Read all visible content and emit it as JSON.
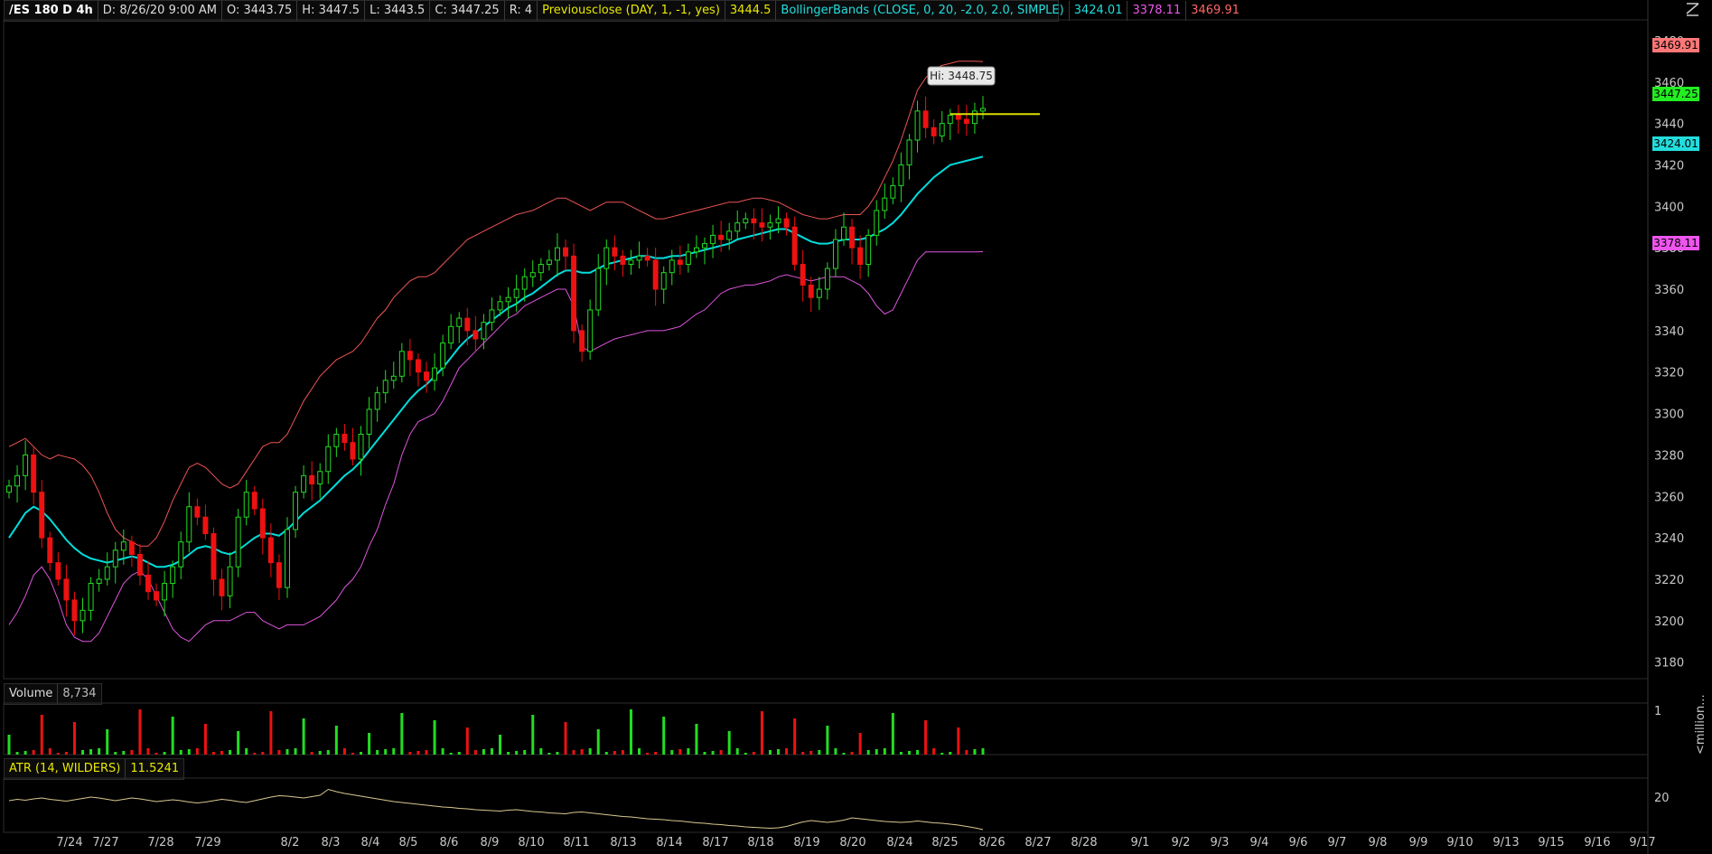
{
  "header": {
    "symbol": "/ES 180 D 4h",
    "datetime": "D: 8/26/20 9:00 AM",
    "open": "O: 3443.75",
    "high": "H: 3447.5",
    "low": "L: 3443.5",
    "close": "C: 3447.25",
    "range": "R: 4",
    "prevclose_label": "Previousclose (DAY, 1, -1, yes)",
    "prevclose_value": "3444.5",
    "bb_label": "BollingerBands (CLOSE, 0, 20, -2.0, 2.0, SIMPLE)",
    "bb_mid": "3424.01",
    "bb_low": "3378.11",
    "bb_up": "3469.91"
  },
  "volume_panel": {
    "label": "Volume",
    "value": "8,734",
    "axis_label": "1",
    "unit_label": "<million..."
  },
  "atr_panel": {
    "label": "ATR (14, WILDERS)",
    "value": "11.5241",
    "axis_label": "20"
  },
  "tooltip": "Hi: 3448.75",
  "colors": {
    "up": "#22dd22",
    "down": "#ee1111",
    "mid": "#00dddd",
    "upper": "#ee5555",
    "lower": "#dd55dd",
    "prevclose": "#dddd00",
    "atr": "#d8c890"
  },
  "chart_data": {
    "type": "candlestick",
    "title": "/ES 180 D 4h",
    "y_ticks": [
      3180,
      3200,
      3220,
      3240,
      3260,
      3280,
      3300,
      3320,
      3340,
      3360,
      3380,
      3400,
      3420,
      3440,
      3460,
      3480
    ],
    "ylim": [
      3172,
      3490
    ],
    "x_ticks": [
      "7/24",
      "7/27",
      "7/28",
      "7/29",
      "8/2",
      "8/3",
      "8/4",
      "8/5",
      "8/6",
      "8/9",
      "8/10",
      "8/11",
      "8/13",
      "8/14",
      "8/17",
      "8/18",
      "8/19",
      "8/20",
      "8/24",
      "8/25",
      "8/26",
      "8/27",
      "8/28",
      "9/1",
      "9/2",
      "9/3",
      "9/4",
      "9/6",
      "9/7",
      "9/8",
      "9/9",
      "9/10",
      "9/13",
      "9/15",
      "9/16",
      "9/17"
    ],
    "price_tags": {
      "bb_upper": "3469.91",
      "last": "3447.25",
      "bb_mid": "3424.01",
      "bb_lower": "3378.11"
    },
    "previous_close": 3444.5,
    "close_series": [
      3265,
      3270,
      3280,
      3262,
      3240,
      3228,
      3220,
      3210,
      3200,
      3205,
      3218,
      3220,
      3226,
      3234,
      3238,
      3232,
      3222,
      3214,
      3210,
      3218,
      3226,
      3238,
      3255,
      3250,
      3242,
      3220,
      3212,
      3226,
      3250,
      3262,
      3254,
      3240,
      3228,
      3216,
      3244,
      3262,
      3270,
      3266,
      3272,
      3284,
      3290,
      3286,
      3278,
      3290,
      3302,
      3310,
      3316,
      3318,
      3330,
      3326,
      3320,
      3316,
      3322,
      3334,
      3342,
      3346,
      3340,
      3336,
      3344,
      3350,
      3354,
      3356,
      3360,
      3366,
      3368,
      3372,
      3374,
      3380,
      3376,
      3340,
      3330,
      3350,
      3370,
      3380,
      3376,
      3372,
      3374,
      3376,
      3374,
      3360,
      3368,
      3374,
      3372,
      3378,
      3380,
      3382,
      3386,
      3384,
      3388,
      3392,
      3394,
      3392,
      3390,
      3392,
      3394,
      3390,
      3372,
      3362,
      3356,
      3360,
      3370,
      3384,
      3390,
      3380,
      3372,
      3386,
      3398,
      3404,
      3410,
      3420,
      3432,
      3446,
      3438,
      3434,
      3440,
      3444,
      3442,
      3440,
      3446,
      3447.25
    ],
    "bb_mid": [
      3240,
      3246,
      3252,
      3255,
      3253,
      3249,
      3244,
      3239,
      3235,
      3232,
      3230,
      3229,
      3228,
      3229,
      3230,
      3231,
      3230,
      3228,
      3226,
      3226,
      3227,
      3229,
      3232,
      3235,
      3236,
      3235,
      3233,
      3232,
      3234,
      3237,
      3240,
      3242,
      3242,
      3241,
      3244,
      3248,
      3252,
      3255,
      3258,
      3262,
      3266,
      3270,
      3273,
      3277,
      3282,
      3287,
      3292,
      3297,
      3302,
      3307,
      3311,
      3314,
      3318,
      3322,
      3327,
      3332,
      3336,
      3339,
      3342,
      3345,
      3348,
      3351,
      3353,
      3356,
      3358,
      3361,
      3364,
      3367,
      3369,
      3369,
      3368,
      3368,
      3370,
      3372,
      3373,
      3374,
      3375,
      3376,
      3376,
      3375,
      3375,
      3376,
      3376,
      3377,
      3378,
      3379,
      3380,
      3381,
      3382,
      3384,
      3385,
      3386,
      3387,
      3388,
      3389,
      3389,
      3387,
      3385,
      3383,
      3382,
      3382,
      3383,
      3384,
      3384,
      3384,
      3385,
      3387,
      3389,
      3392,
      3396,
      3401,
      3406,
      3410,
      3414,
      3417,
      3420,
      3421,
      3422,
      3423,
      3424.01
    ],
    "bb_upper": [
      3284,
      3286,
      3288,
      3284,
      3280,
      3278,
      3280,
      3279,
      3278,
      3275,
      3270,
      3262,
      3252,
      3244,
      3240,
      3238,
      3236,
      3236,
      3240,
      3248,
      3258,
      3266,
      3274,
      3276,
      3274,
      3270,
      3266,
      3264,
      3266,
      3272,
      3278,
      3284,
      3286,
      3286,
      3290,
      3298,
      3306,
      3312,
      3318,
      3322,
      3326,
      3328,
      3330,
      3334,
      3340,
      3346,
      3350,
      3356,
      3360,
      3364,
      3366,
      3366,
      3368,
      3372,
      3376,
      3380,
      3384,
      3386,
      3388,
      3390,
      3392,
      3394,
      3396,
      3397,
      3398,
      3400,
      3402,
      3404,
      3404,
      3402,
      3400,
      3398,
      3400,
      3402,
      3402,
      3402,
      3400,
      3398,
      3396,
      3394,
      3394,
      3395,
      3396,
      3397,
      3398,
      3399,
      3400,
      3401,
      3402,
      3402,
      3403,
      3404,
      3404,
      3403,
      3402,
      3400,
      3398,
      3396,
      3395,
      3394,
      3394,
      3395,
      3396,
      3396,
      3396,
      3400,
      3406,
      3414,
      3422,
      3432,
      3444,
      3456,
      3462,
      3466,
      3468,
      3469,
      3470,
      3470,
      3470,
      3469.91
    ],
    "bb_lower": [
      3198,
      3204,
      3212,
      3222,
      3226,
      3220,
      3210,
      3198,
      3192,
      3190,
      3190,
      3194,
      3202,
      3210,
      3218,
      3222,
      3224,
      3220,
      3212,
      3204,
      3196,
      3192,
      3190,
      3194,
      3198,
      3200,
      3200,
      3200,
      3202,
      3204,
      3204,
      3200,
      3198,
      3196,
      3198,
      3198,
      3198,
      3200,
      3202,
      3206,
      3210,
      3216,
      3220,
      3226,
      3236,
      3244,
      3256,
      3266,
      3280,
      3290,
      3296,
      3298,
      3300,
      3306,
      3314,
      3322,
      3326,
      3330,
      3334,
      3338,
      3342,
      3346,
      3348,
      3352,
      3354,
      3356,
      3358,
      3360,
      3360,
      3352,
      3332,
      3330,
      3332,
      3334,
      3336,
      3337,
      3338,
      3339,
      3340,
      3340,
      3340,
      3341,
      3342,
      3345,
      3348,
      3350,
      3354,
      3358,
      3360,
      3361,
      3362,
      3362,
      3363,
      3364,
      3366,
      3367,
      3366,
      3365,
      3364,
      3365,
      3366,
      3366,
      3366,
      3364,
      3362,
      3358,
      3352,
      3348,
      3350,
      3358,
      3366,
      3374,
      3378,
      3378,
      3378,
      3378,
      3378,
      3378,
      3378,
      3378.11
    ],
    "atr_ylim": [
      15,
      27
    ],
    "atr_series": [
      22,
      22.3,
      22.1,
      22.4,
      22.6,
      22.3,
      22.1,
      21.9,
      22.2,
      22.5,
      22.8,
      22.6,
      22.3,
      22.0,
      22.3,
      22.6,
      22.4,
      22.1,
      21.8,
      22.0,
      22.2,
      22.0,
      21.7,
      21.5,
      21.7,
      22.0,
      22.3,
      22.1,
      21.8,
      21.6,
      22.0,
      22.4,
      22.8,
      23.1,
      23.0,
      22.8,
      22.6,
      22.9,
      23.2,
      24.5,
      24.0,
      23.6,
      23.3,
      23.0,
      22.7,
      22.4,
      22.1,
      21.8,
      21.6,
      21.4,
      21.2,
      21.0,
      20.8,
      20.6,
      20.5,
      20.3,
      20.2,
      20.0,
      19.9,
      19.8,
      19.7,
      19.9,
      20.0,
      19.8,
      19.6,
      19.5,
      19.3,
      19.2,
      19.1,
      19.4,
      19.5,
      19.3,
      19.1,
      18.9,
      18.7,
      18.5,
      18.4,
      18.2,
      18.0,
      17.9,
      17.8,
      17.6,
      17.5,
      17.3,
      17.1,
      17.0,
      16.8,
      16.7,
      16.5,
      16.4,
      16.2,
      16.1,
      16.0,
      15.9,
      16.0,
      16.3,
      16.8,
      17.3,
      17.6,
      17.4,
      17.2,
      17.4,
      17.7,
      18.2,
      18.0,
      17.8,
      17.6,
      17.4,
      17.3,
      17.2,
      17.3,
      17.5,
      17.3,
      17.1,
      17.0,
      16.8,
      16.6,
      16.3,
      16.0,
      15.6
    ]
  }
}
